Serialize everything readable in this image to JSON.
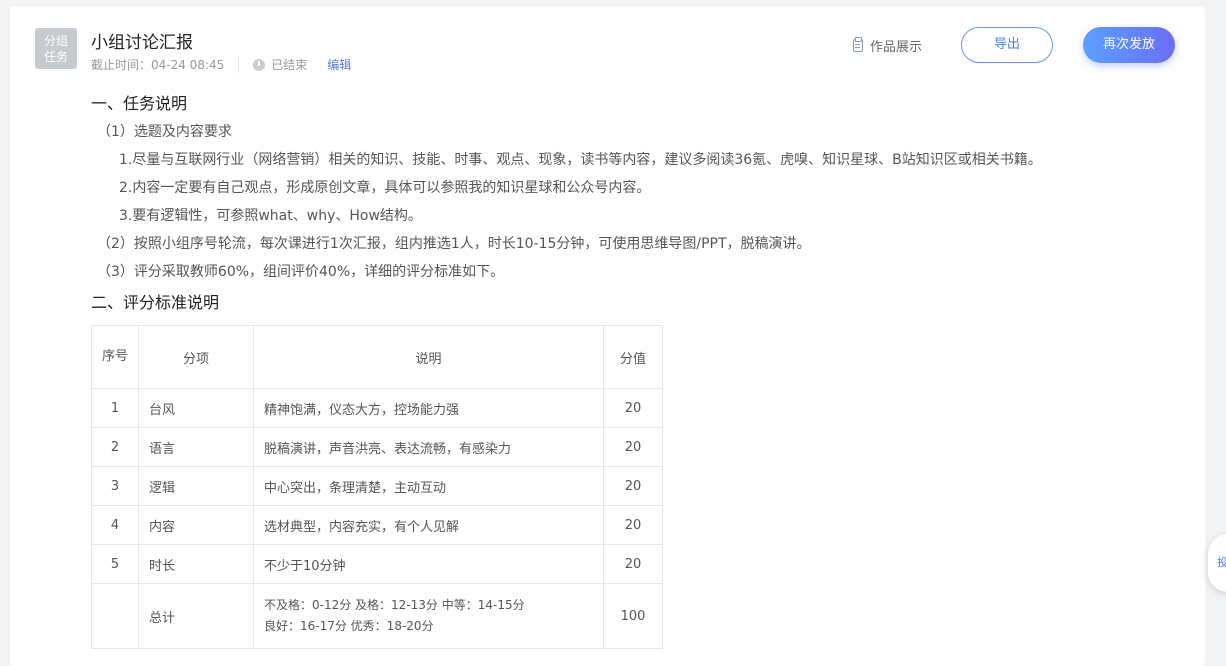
{
  "badge": {
    "line1": "分组",
    "line2": "任务"
  },
  "header": {
    "title": "小组讨论汇报",
    "deadline": "截止时间：04-24 08:45",
    "status": "已结束",
    "edit": "编辑",
    "showcase": "作品展示",
    "export": "导出",
    "resend": "再次发放"
  },
  "section1": {
    "heading": "一、任务说明",
    "items": [
      "（1）选题及内容要求",
      "1.尽量与互联网行业（网络营销）相关的知识、技能、时事、观点、现象，读书等内容，建议多阅读36氪、虎嗅、知识星球、B站知识区或相关书籍。",
      "2.内容一定要有自己观点，形成原创文章，具体可以参照我的知识星球和公众号内容。",
      "3.要有逻辑性，可参照what、why、How结构。",
      "（2）按照小组序号轮流，每次课进行1次汇报，组内推选1人，时长10-15分钟，可使用思维导图/PPT，脱稿演讲。",
      "（3）评分采取教师60%，组间评价40%，详细的评分标准如下。"
    ]
  },
  "section2": {
    "heading": "二、评分标准说明"
  },
  "table": {
    "headers": {
      "no": "序号",
      "item": "分项",
      "desc": "说明",
      "score": "分值"
    },
    "rows": [
      {
        "no": "1",
        "item": "台风",
        "desc": "精神饱满，仪态大方，控场能力强",
        "score": "20"
      },
      {
        "no": "2",
        "item": "语言",
        "desc": "脱稿演讲，声音洪亮、表达流畅，有感染力",
        "score": "20"
      },
      {
        "no": "3",
        "item": "逻辑",
        "desc": "中心突出，条理清楚，主动互动",
        "score": "20"
      },
      {
        "no": "4",
        "item": "内容",
        "desc": "选材典型，内容充实，有个人见解",
        "score": "20"
      },
      {
        "no": "5",
        "item": "时长",
        "desc": "不少于10分钟",
        "score": "20"
      }
    ],
    "total": {
      "no": "",
      "item": "总计",
      "desc1": "不及格：0-12分 及格：12-13分 中等：14-15分",
      "desc2": "良好：16-17分 优秀：18-20分",
      "score": "100"
    }
  },
  "float_tab": "投"
}
